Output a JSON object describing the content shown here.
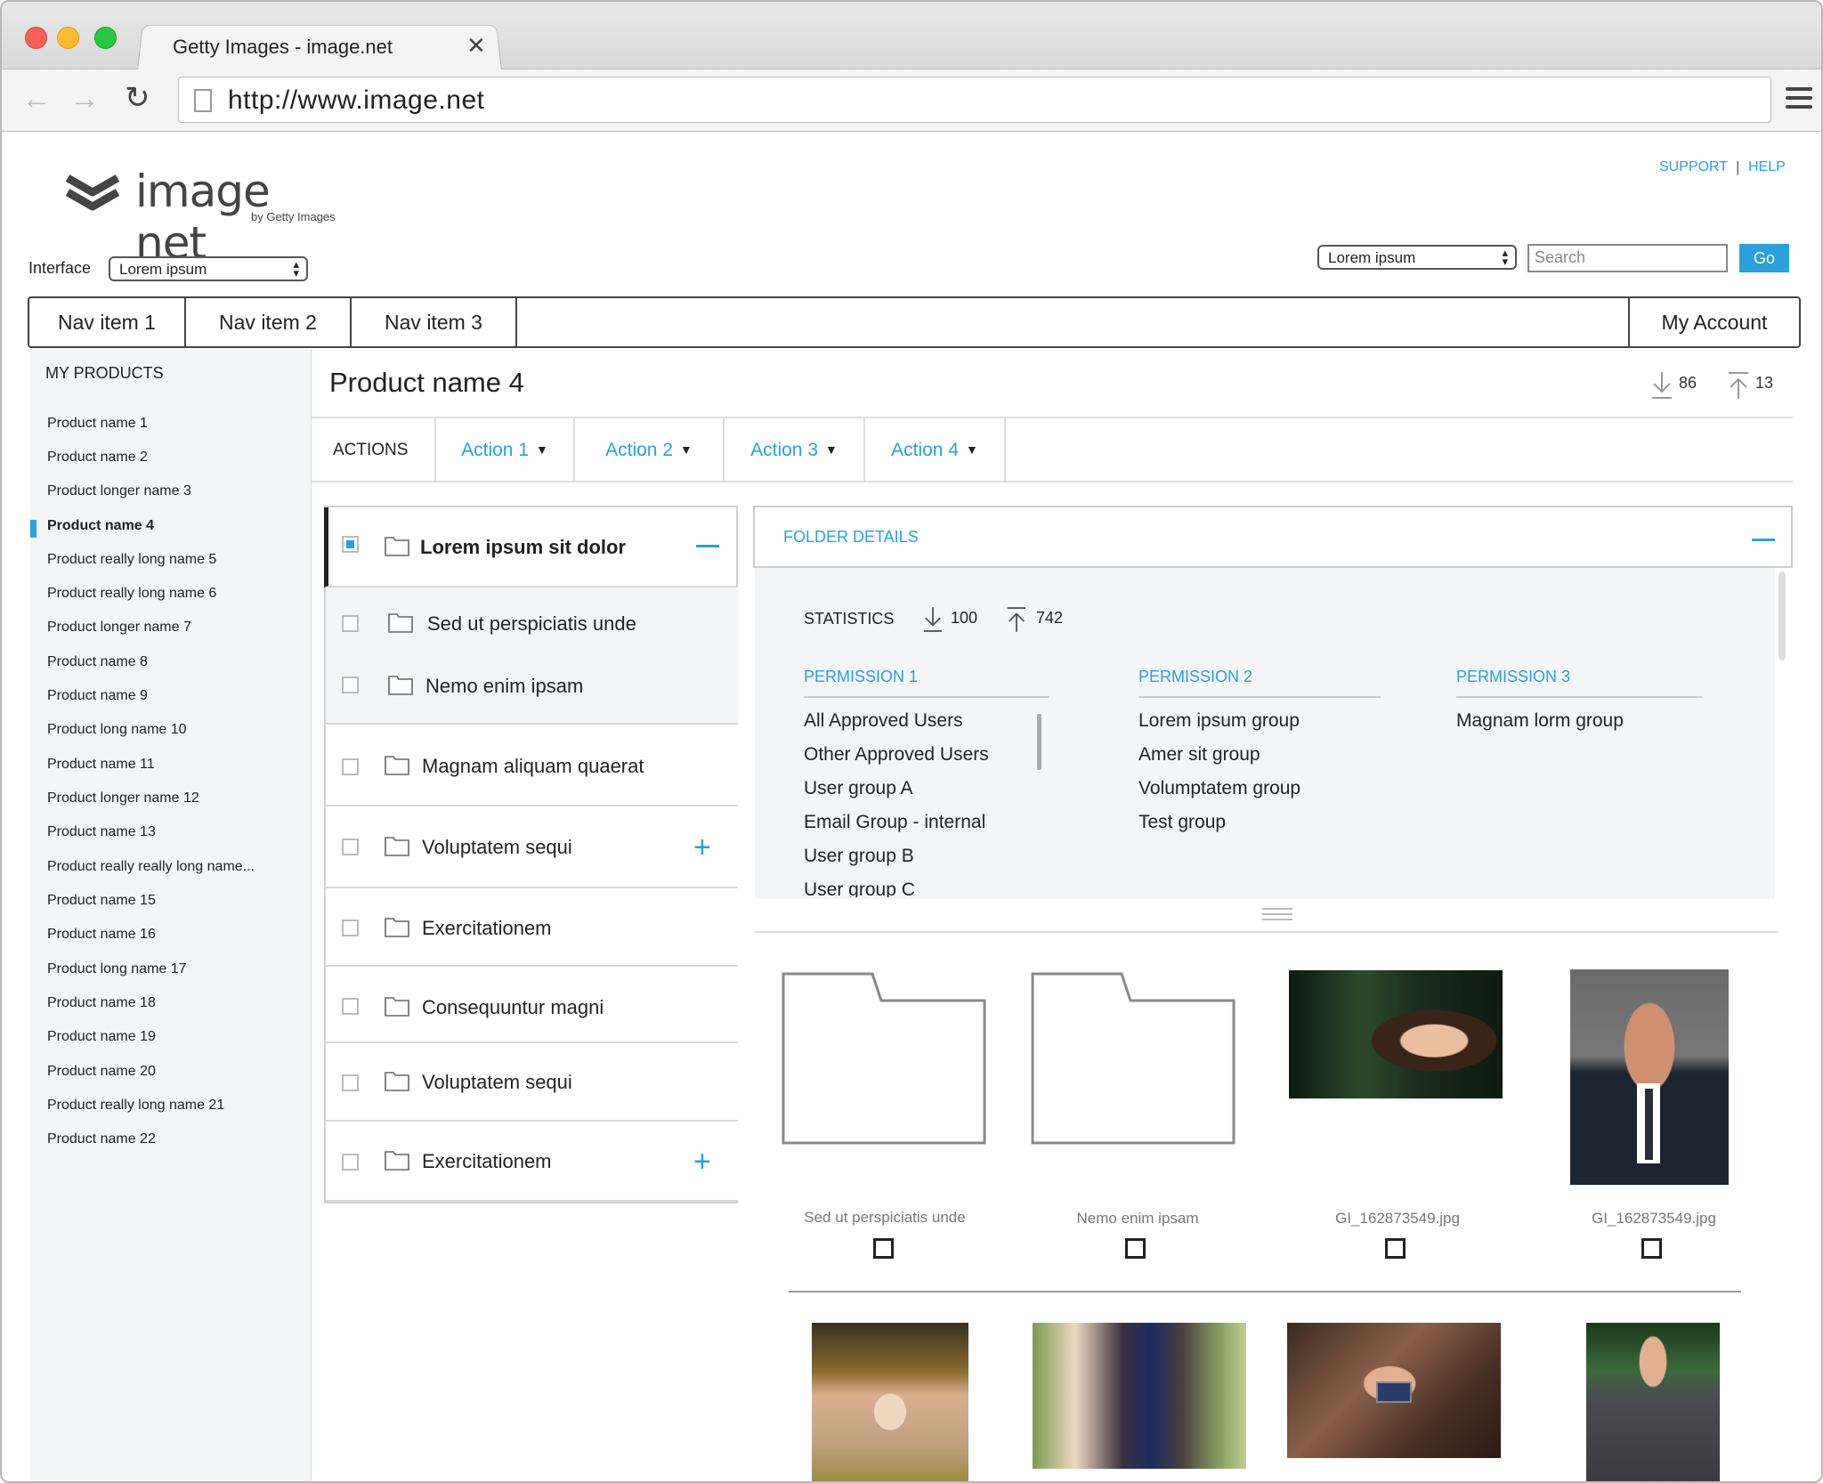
{
  "browser": {
    "tab_title": "Getty Images - image.net",
    "url": "http://www.image.net"
  },
  "header": {
    "logo_text": "image net",
    "logo_sub": "by Getty Images",
    "support": "SUPPORT",
    "separator": "|",
    "help": "HELP",
    "interface_label": "Interface",
    "interface_value": "Lorem ipsum",
    "search_scope": "Lorem ipsum",
    "search_placeholder": "Search",
    "go_label": "Go"
  },
  "nav": {
    "items": [
      "Nav item 1",
      "Nav item 2",
      "Nav item 3"
    ],
    "account": "My Account"
  },
  "sidebar": {
    "title": "MY PRODUCTS",
    "items": [
      "Product name 1",
      "Product name 2",
      "Product longer name 3",
      "Product name 4",
      "Product really long name 5",
      "Product really long name 6",
      "Product longer name 7",
      "Product name 8",
      "Product name 9",
      "Product long name 10",
      "Product name 11",
      "Product longer name 12",
      "Product name 13",
      "Product really really long name...",
      "Product name 15",
      "Product name 16",
      "Product long name 17",
      "Product name 18",
      "Product name 19",
      "Product name 20",
      "Product really long name 21",
      "Product name 22"
    ],
    "active_index": 3
  },
  "main": {
    "title": "Product name 4",
    "downloads": "86",
    "uploads": "13",
    "actions_label": "ACTIONS",
    "actions": [
      "Action 1",
      "Action 2",
      "Action 3",
      "Action 4"
    ]
  },
  "folders": [
    {
      "label": "Lorem ipsum sit dolor",
      "checked": true,
      "expanded": true
    },
    {
      "label": "Sed ut perspiciatis unde",
      "sub": true
    },
    {
      "label": "Nemo enim ipsam",
      "sub": true
    },
    {
      "label": "Magnam aliquam quaerat"
    },
    {
      "label": "Voluptatem sequi",
      "expandable": true
    },
    {
      "label": "Exercitationem"
    },
    {
      "label": "Consequuntur magni"
    },
    {
      "label": "Voluptatem sequi"
    },
    {
      "label": "Exercitationem",
      "expandable": true
    }
  ],
  "folder_details": {
    "title": "FOLDER DETAILS",
    "statistics_label": "STATISTICS",
    "stat_downloads": "100",
    "stat_uploads": "742",
    "permissions": [
      {
        "title": "PERMISSION 1",
        "items": [
          "All Approved Users",
          "Other Approved Users",
          "User group A",
          "Email Group - internal",
          "User group B",
          "User group C"
        ]
      },
      {
        "title": "PERMISSION 2",
        "items": [
          "Lorem ipsum group",
          "Amer sit group",
          "Volumptatem group",
          "Test group"
        ]
      },
      {
        "title": "PERMISSION 3",
        "items": [
          "Magnam lorm group"
        ]
      }
    ]
  },
  "grid": {
    "captions": [
      "Sed ut perspiciatis unde",
      "Nemo enim ipsam",
      "GI_162873549.jpg",
      "GI_162873549.jpg"
    ]
  },
  "colors": {
    "accent": "#2aa0dc",
    "sidebar_bg": "#f4f5f7"
  }
}
